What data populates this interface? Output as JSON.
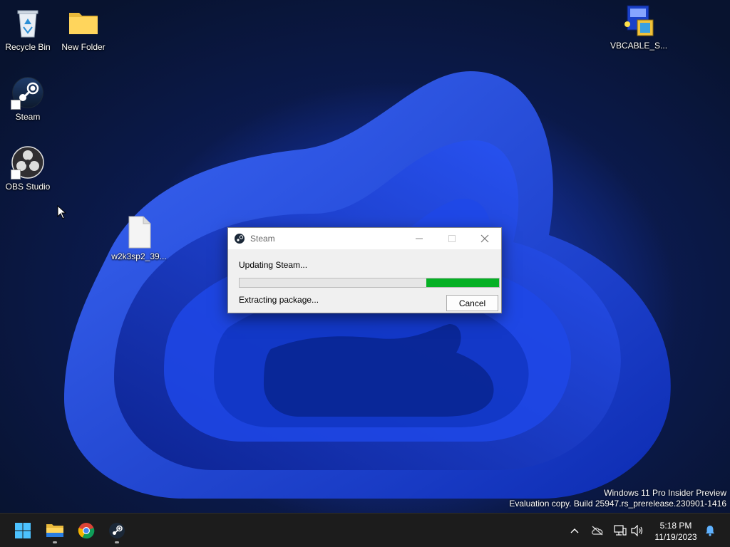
{
  "desktop": {
    "icons": [
      {
        "label": "Recycle Bin"
      },
      {
        "label": "New Folder"
      },
      {
        "label": "Steam"
      },
      {
        "label": "OBS Studio"
      },
      {
        "label": "w2k3sp2_39..."
      },
      {
        "label": "VBCABLE_S..."
      }
    ]
  },
  "dialog": {
    "title": "Steam",
    "status": "Updating Steam...",
    "substatus": "Extracting package...",
    "cancel_label": "Cancel",
    "progress_fraction": 0.28
  },
  "watermark": {
    "line1": "Windows 11 Pro Insider Preview",
    "line2": "Evaluation copy. Build 25947.rs_prerelease.230901-1416"
  },
  "taskbar": {
    "apps": [
      "start-icon",
      "file-explorer-icon",
      "chrome-icon",
      "steam-icon"
    ],
    "time": "5:18 PM",
    "date": "11/19/2023"
  },
  "colors": {
    "progress": "#06b025",
    "taskbar": "#1c1c1c"
  }
}
